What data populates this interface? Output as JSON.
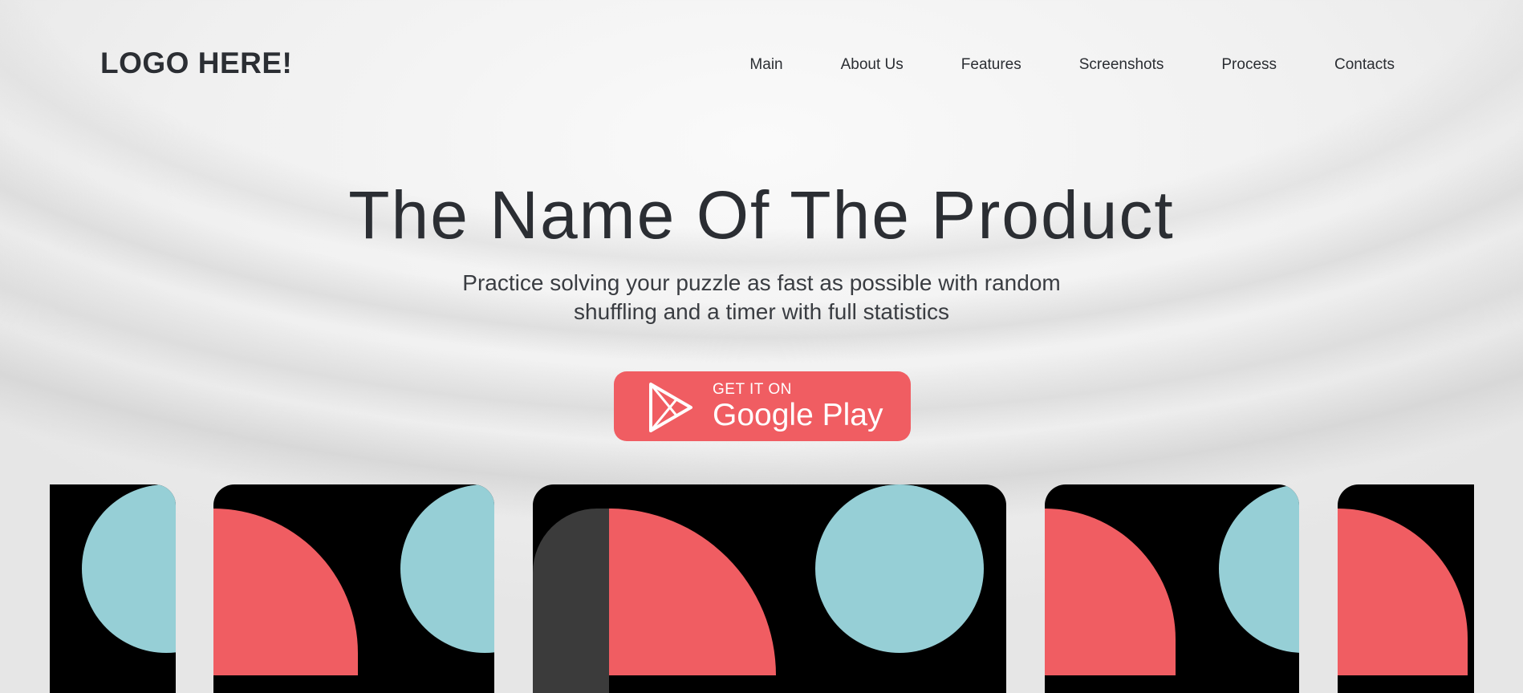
{
  "header": {
    "logo": "LOGO HERE!",
    "nav": [
      "Main",
      "About Us",
      "Features",
      "Screenshots",
      "Process",
      "Contacts"
    ]
  },
  "hero": {
    "title": "The Name Of The Product",
    "subtitle": "Practice solving your puzzle as fast as possible with random shuffling and a timer with full statistics"
  },
  "store_button": {
    "small": "GET IT ON",
    "big": "Google Play",
    "icon": "play-store-icon",
    "color": "#f05d62"
  },
  "colors": {
    "accent_red": "#f05d62",
    "teal": "#96cfd6",
    "text": "#2b2e33"
  }
}
